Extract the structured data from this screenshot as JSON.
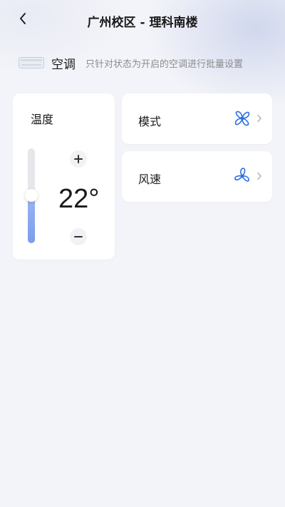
{
  "header": {
    "title": "广州校区 - 理科南楼",
    "back_icon": "chevron-left-icon"
  },
  "device": {
    "icon": "air-conditioner-icon",
    "name": "空调",
    "hint": "只针对状态为开启的空调进行批量设置"
  },
  "temperature": {
    "label": "温度",
    "value": "22°",
    "level": 0.5,
    "increase_icon": "plus-icon",
    "decrease_icon": "minus-icon",
    "accent": "#7b9deb"
  },
  "options": [
    {
      "label": "模式",
      "icon": "pinwheel-icon"
    },
    {
      "label": "风速",
      "icon": "fan-icon"
    }
  ],
  "colors": {
    "accent_blue": "#2f6fe0",
    "background": "#f3f4f9",
    "card": "#ffffff",
    "hint_text": "#8c8c8c"
  }
}
